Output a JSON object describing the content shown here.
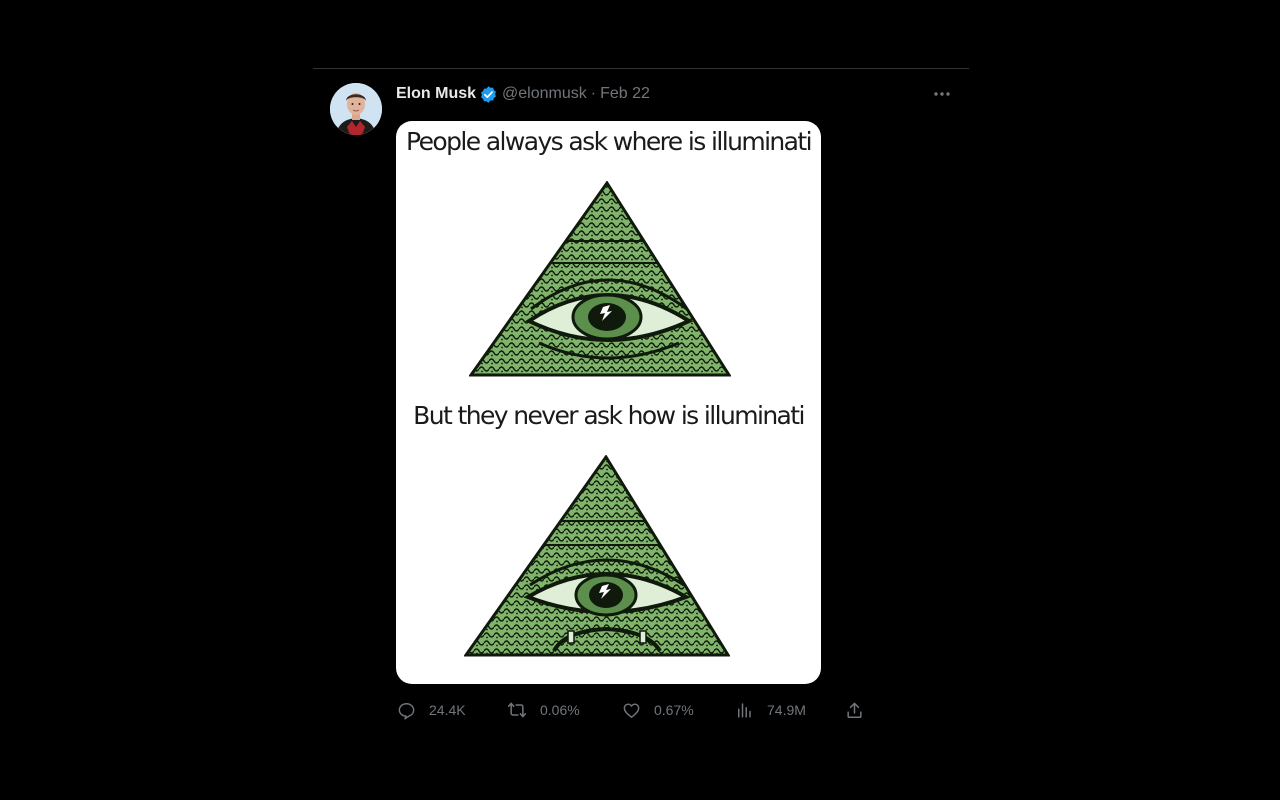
{
  "tweet": {
    "author_name": "Elon Musk",
    "handle": "@elonmusk",
    "separator": "·",
    "date": "Feb 22",
    "verified": true,
    "avatar": "profile-photo",
    "more_icon": "more-horizontal-icon"
  },
  "media": {
    "caption_top": "People always ask where is illuminati",
    "caption_bottom": "But they never ask how is illuminati",
    "image_top": "illuminati-pyramid-eye",
    "image_bottom": "illuminati-pyramid-eye-sad"
  },
  "actions": {
    "replies": "24.4K",
    "retweets": "0.06%",
    "likes": "0.67%",
    "views": "74.9M",
    "share_icon": "share-icon"
  },
  "colors": {
    "background": "#000000",
    "primary_text": "#e7e9ea",
    "secondary_text": "#71767b",
    "verified_blue": "#1d9bf0",
    "divider": "#2f3336",
    "pyramid_green": "#7fb46a"
  }
}
